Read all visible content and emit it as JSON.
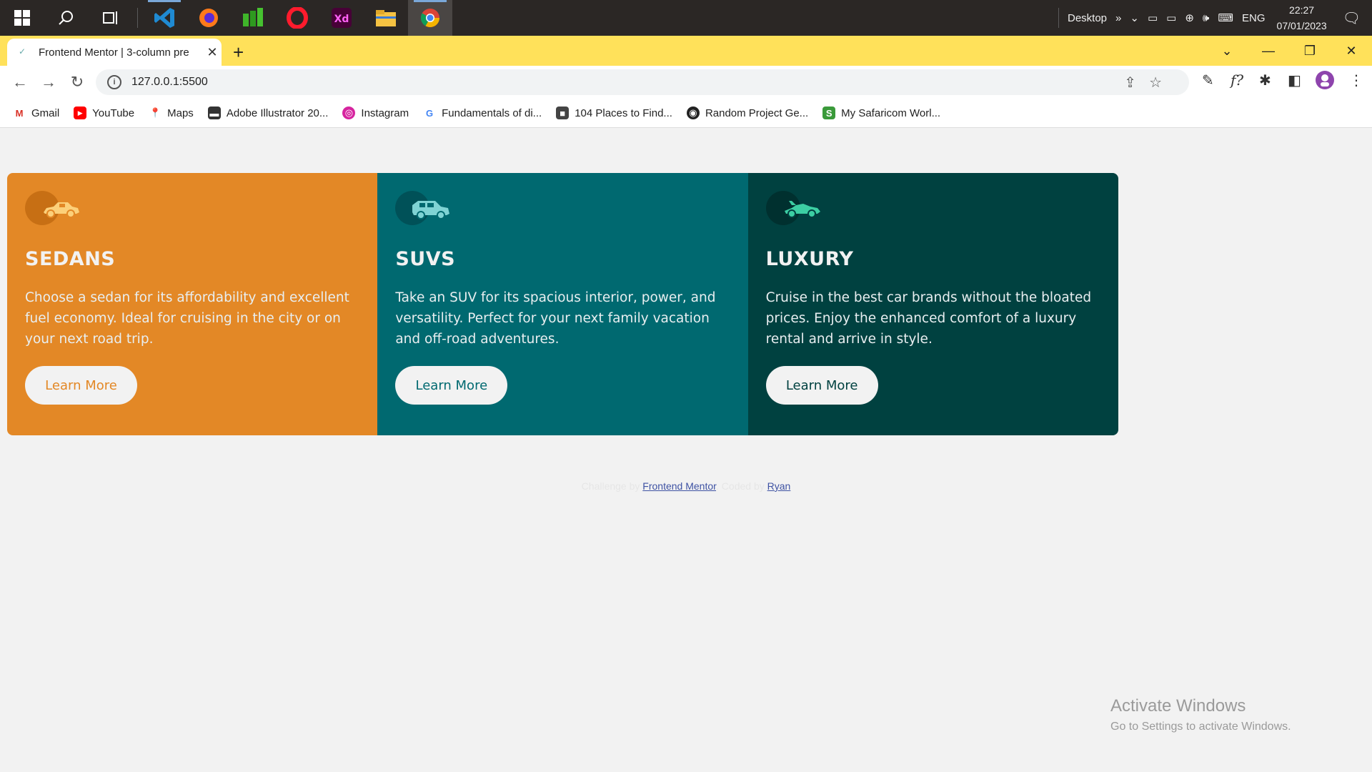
{
  "taskbar": {
    "desktop_label": "Desktop",
    "lang": "ENG",
    "time": "22:27",
    "date": "07/01/2023",
    "apps": [
      "windows-start",
      "search",
      "task-view",
      "vscode",
      "firefox",
      "app-green",
      "opera",
      "adobe-xd",
      "file-explorer",
      "chrome"
    ]
  },
  "browser": {
    "tab_title": "Frontend Mentor | 3-column pre",
    "url": "127.0.0.1:5500",
    "bookmarks": [
      {
        "label": "Gmail",
        "icon": "gmail-icon",
        "color": "#d93025",
        "glyph": "M"
      },
      {
        "label": "YouTube",
        "icon": "youtube-icon",
        "color": "#ff0000",
        "glyph": "▶"
      },
      {
        "label": "Maps",
        "icon": "maps-icon",
        "color": "#34a853",
        "glyph": "⬤"
      },
      {
        "label": "Adobe Illustrator 20...",
        "icon": "illustrator-icon",
        "color": "#333333",
        "glyph": "■"
      },
      {
        "label": "Instagram",
        "icon": "instagram-icon",
        "color": "#d6249f",
        "glyph": "◎"
      },
      {
        "label": "Fundamentals of di...",
        "icon": "google-icon",
        "color": "#4285f4",
        "glyph": "G"
      },
      {
        "label": "104 Places to Find...",
        "icon": "site-icon",
        "color": "#444444",
        "glyph": "■"
      },
      {
        "label": "Random Project Ge...",
        "icon": "globe-icon",
        "color": "#222222",
        "glyph": "◉"
      },
      {
        "label": "My Safaricom Worl...",
        "icon": "safaricom-icon",
        "color": "#3a9a3a",
        "glyph": "S"
      }
    ]
  },
  "cards": [
    {
      "title": "SEDANS",
      "text": "Choose a sedan for its affordability and excellent fuel economy. Ideal for cruising in the city or on your next road trip.",
      "button": "Learn More",
      "bg": "#e38826",
      "button_color": "#e38826",
      "icon": "sedan-icon"
    },
    {
      "title": "SUVS",
      "text": "Take an SUV for its spacious interior, power, and versatility. Perfect for your next family vacation and off-road adventures.",
      "button": "Learn More",
      "bg": "#006970",
      "button_color": "#006970",
      "icon": "suv-icon"
    },
    {
      "title": "LUXURY",
      "text": "Cruise in the best car brands without the bloated prices. Enjoy the enhanced comfort of a luxury rental and arrive in style.",
      "button": "Learn More",
      "bg": "#004140",
      "button_color": "#004140",
      "icon": "luxury-car-icon"
    }
  ],
  "attribution": {
    "prefix": "Challenge by",
    "link1": "Frontend Mentor",
    "middle": ". Coded by",
    "link2": "Ryan"
  },
  "watermark": {
    "line1": "Activate Windows",
    "line2": "Go to Settings to activate Windows."
  }
}
